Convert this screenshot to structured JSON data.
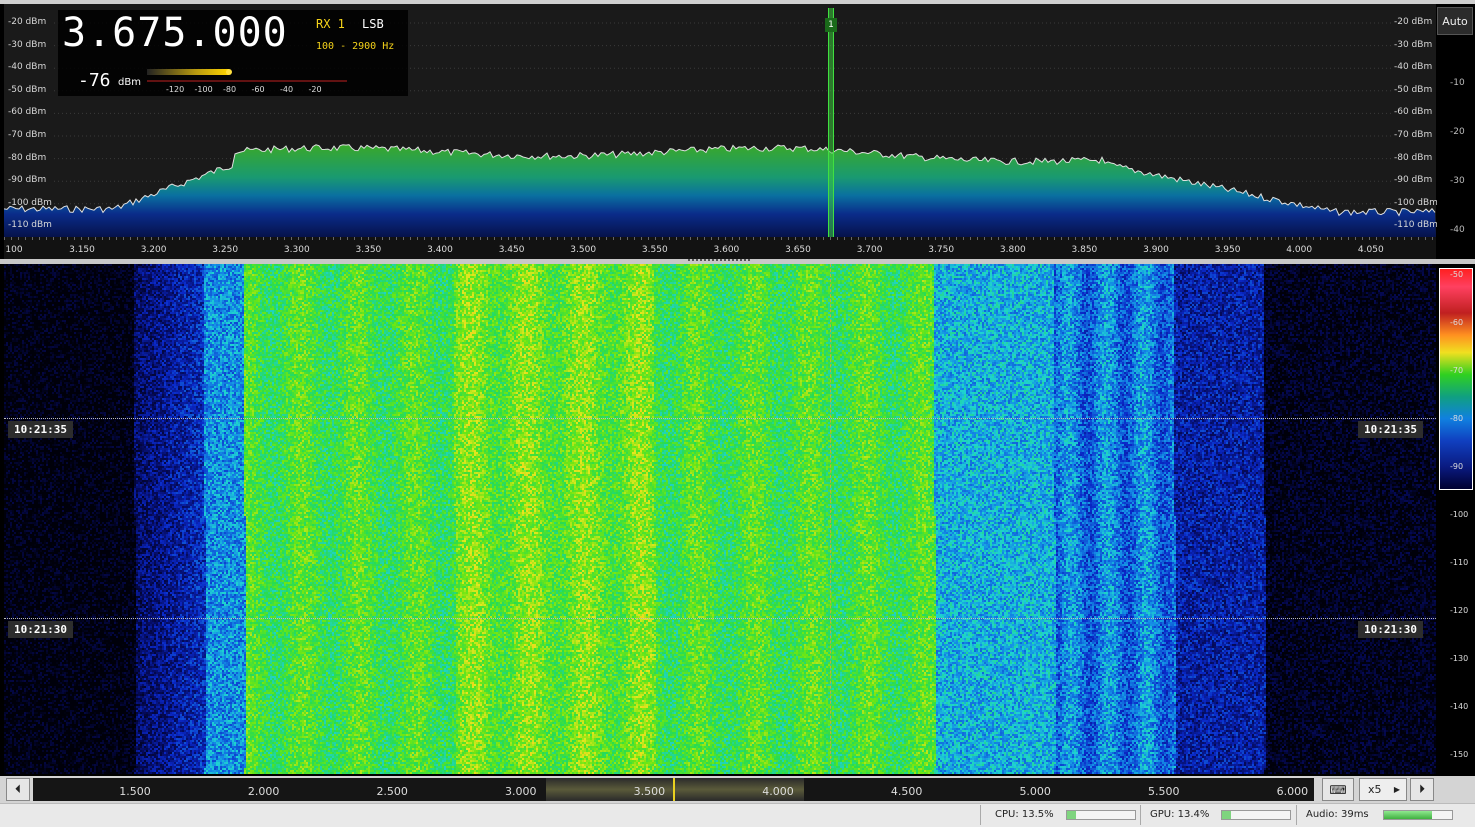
{
  "frequency": "3.675.000",
  "receiver": "RX 1",
  "mode": "LSB",
  "bandwidth": "100 - 2900 Hz",
  "smeter": {
    "value": "-76",
    "unit": "dBm",
    "ticks": [
      "-120",
      "-100",
      "-80",
      "-60",
      "-40",
      "-20"
    ],
    "level": -76
  },
  "spectrum": {
    "db_labels": [
      "-20 dBm",
      "-30 dBm",
      "-40 dBm",
      "-50 dBm",
      "-60 dBm",
      "-70 dBm",
      "-80 dBm",
      "-90 dBm",
      "-100 dBm",
      "-110 dBm"
    ],
    "right_scale": [
      "-10",
      "-20",
      "-30",
      "-40"
    ],
    "auto_label": "Auto",
    "marker_label": "1"
  },
  "freq_axis": [
    "100",
    "3.150",
    "3.200",
    "3.250",
    "3.300",
    "3.350",
    "3.400",
    "3.450",
    "3.500",
    "3.550",
    "3.600",
    "3.650",
    "3.700",
    "3.750",
    "3.800",
    "3.850",
    "3.900",
    "3.950",
    "4.000",
    "4.050"
  ],
  "waterfall": {
    "timestamps": [
      "10:21:35",
      "10:21:30"
    ],
    "colorbar_labels": [
      "-50",
      "-60",
      "-70",
      "-80",
      "-90",
      "-100",
      "-110",
      "-120",
      "-130",
      "-140",
      "-150"
    ]
  },
  "nav": {
    "ticks": [
      "1.500",
      "2.000",
      "2.500",
      "3.000",
      "3.500",
      "4.000",
      "4.500",
      "5.000",
      "5.500",
      "6.000"
    ],
    "zoom": "x5"
  },
  "status": {
    "cpu": "CPU: 13.5%",
    "gpu": "GPU: 13.4%",
    "audio": "Audio: 39ms",
    "cpu_level": 0.135,
    "gpu_level": 0.134
  },
  "colors": {
    "trace": "#e0e0e0",
    "accent": "#f4d21a",
    "marker": "#30c030"
  },
  "icons": [
    "scroll-left-icon",
    "scroll-right-icon",
    "keyboard-icon",
    "chevron-right-icon"
  ]
}
